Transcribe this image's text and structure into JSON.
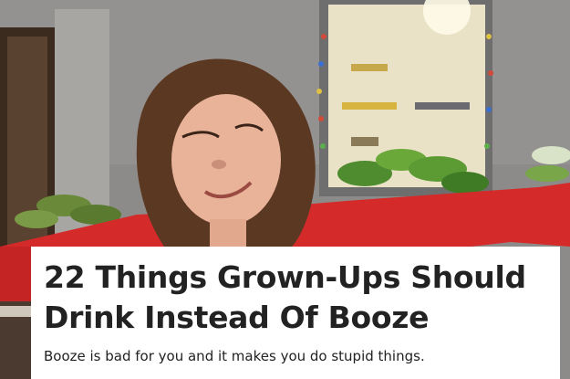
{
  "article": {
    "title": "22 Things Grown-Ups Should Drink Instead Of Booze",
    "dek": "Booze is bad for you and it makes you do stupid things."
  },
  "photo": {
    "description_icon": "child-with-arms-outstretched-photo"
  },
  "colors": {
    "shirt": "#d42a2a",
    "wall": "#8c8c8c",
    "card_background": "#ffffff",
    "text": "#222222"
  }
}
